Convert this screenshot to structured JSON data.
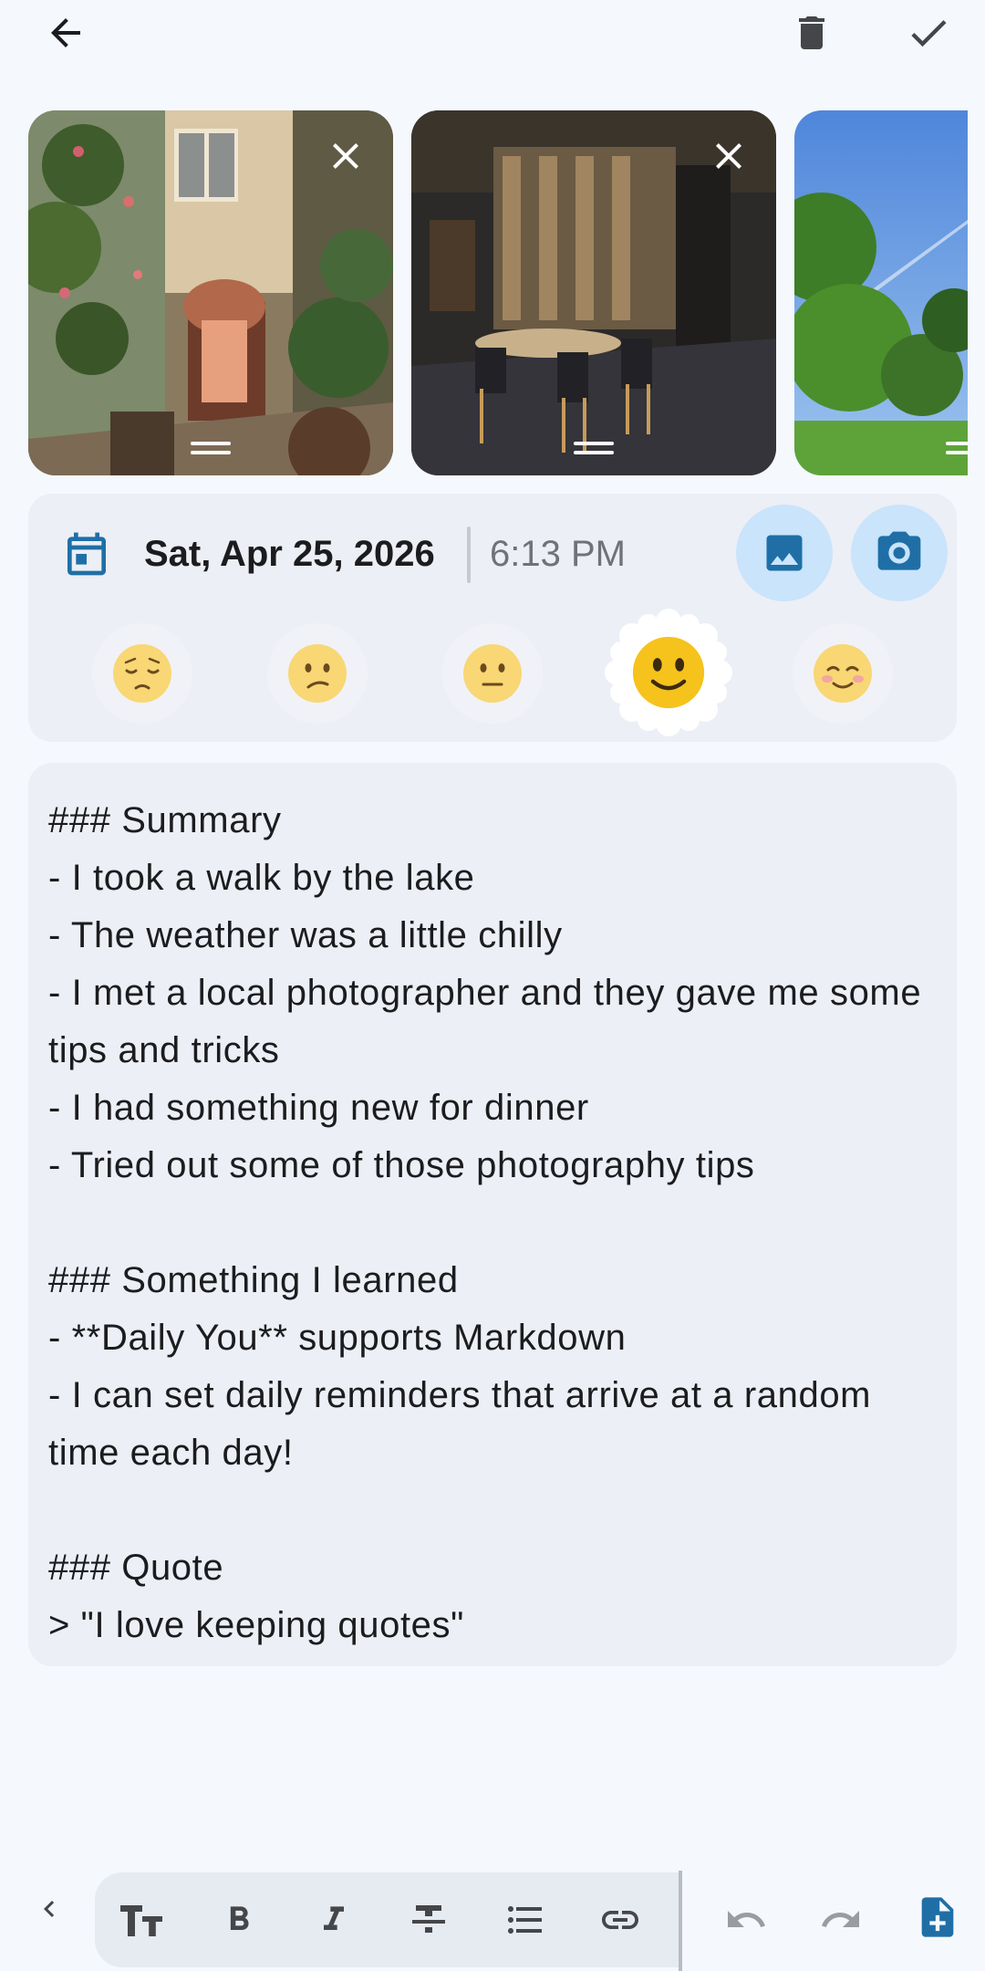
{
  "topbar": {
    "back_icon": "arrow-back-icon",
    "delete_icon": "trash-icon",
    "save_icon": "checkmark-icon"
  },
  "photos": [
    {
      "icon": "close-icon",
      "drag_icon": "drag-handle-icon"
    },
    {
      "icon": "close-icon",
      "drag_icon": "drag-handle-icon"
    },
    {
      "drag_icon": "drag-handle-icon"
    }
  ],
  "entry": {
    "date": "Sat, Apr 25, 2026",
    "time": "6:13 PM",
    "calendar_icon": "calendar-icon",
    "gallery_icon": "image-icon",
    "camera_icon": "camera-icon",
    "accent_color": "#1f7ab8",
    "button_bg": "#c9e4fb"
  },
  "moods": [
    {
      "name": "pensive",
      "selected": false
    },
    {
      "name": "confused",
      "selected": false
    },
    {
      "name": "neutral",
      "selected": false
    },
    {
      "name": "slightly-smiling",
      "selected": true
    },
    {
      "name": "smiling-blushing",
      "selected": false
    }
  ],
  "editor": {
    "text": "### Summary\n- I took a walk by the lake\n- The weather was a little chilly\n- I met a local photographer and they gave me some tips and tricks\n- I had something new for dinner\n- Tried out some of those photography tips\n\n### Something I learned\n- **Daily You** supports Markdown\n- I can set daily reminders that arrive at a random time each day!\n\n### Quote\n> \"I love keeping quotes\""
  },
  "toolbar": {
    "collapse_icon": "chevron-left-icon",
    "format_icons": [
      "text-size-icon",
      "bold-icon",
      "italic-icon",
      "strikethrough-icon",
      "bullet-list-icon",
      "link-icon"
    ],
    "undo_icon": "undo-icon",
    "redo_icon": "redo-icon",
    "new_doc_icon": "note-add-icon"
  }
}
